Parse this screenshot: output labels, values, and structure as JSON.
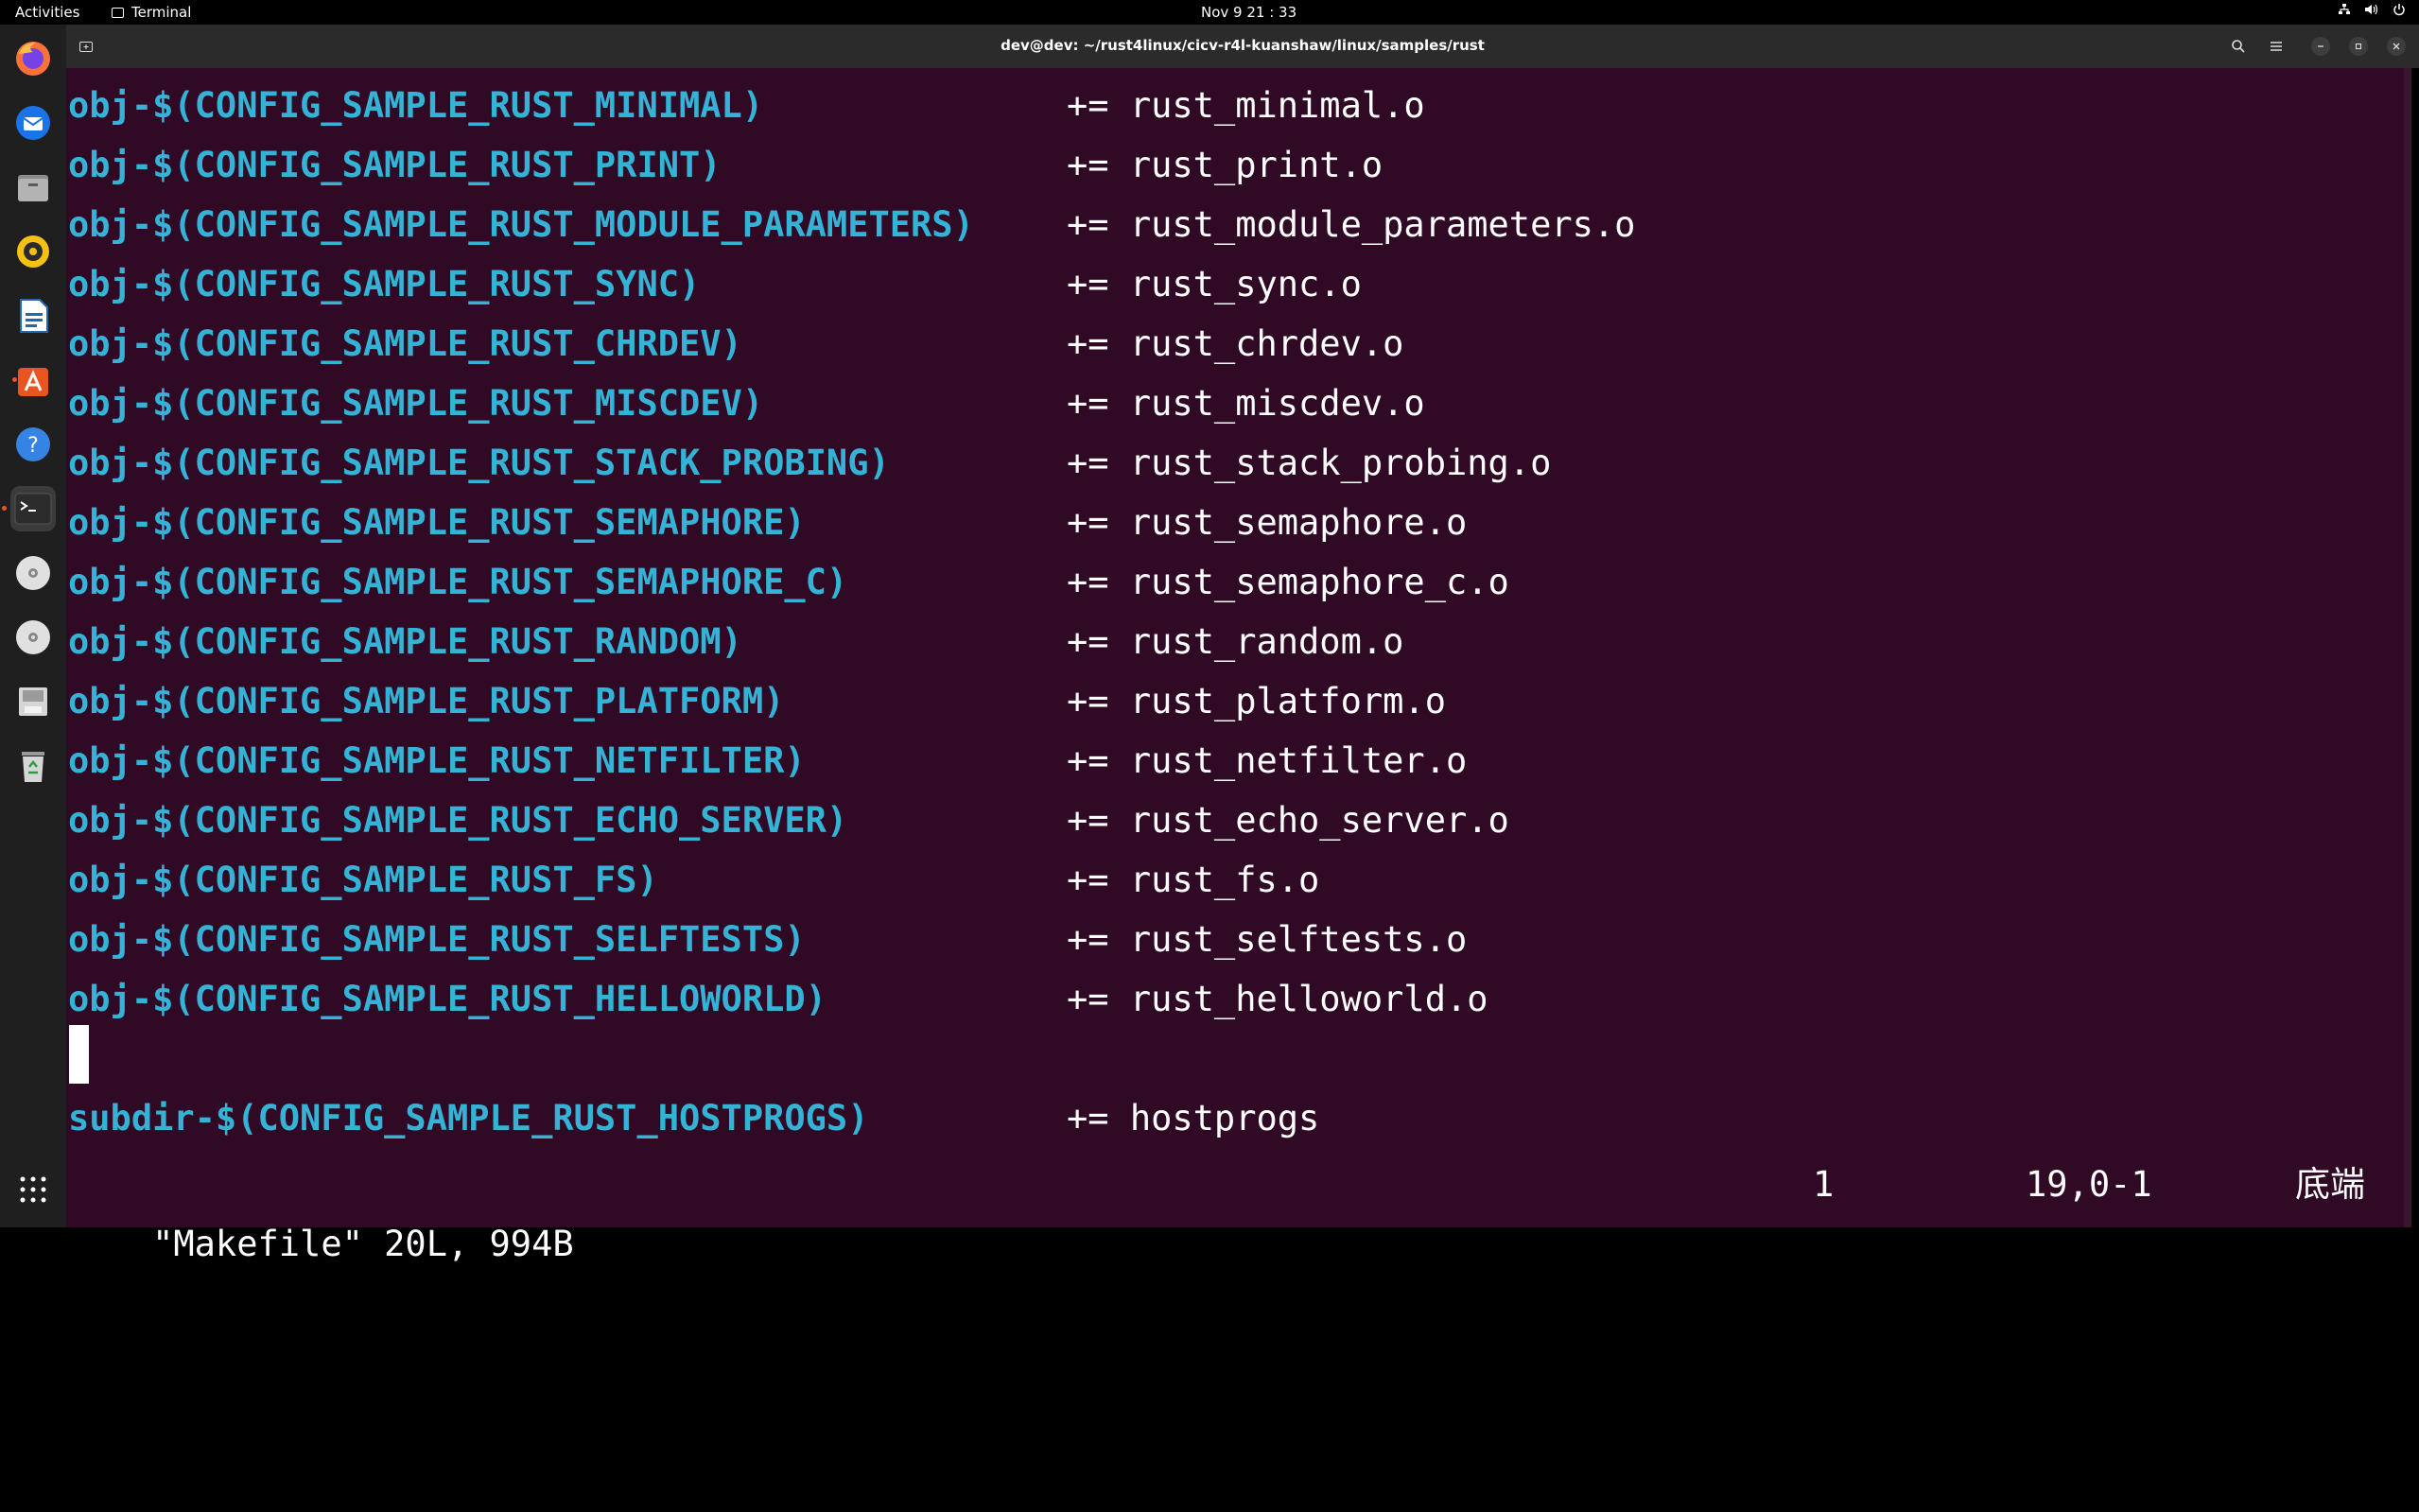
{
  "topbar": {
    "activities": "Activities",
    "app_name": "Terminal",
    "clock": "Nov 9  21 : 33",
    "sys_icons": [
      "network-icon",
      "volume-icon",
      "power-icon"
    ]
  },
  "dock": {
    "items": [
      {
        "name": "firefox-icon"
      },
      {
        "name": "thunderbird-icon"
      },
      {
        "name": "files-icon"
      },
      {
        "name": "rhythmbox-icon"
      },
      {
        "name": "libreoffice-writer-icon"
      },
      {
        "name": "app-center-icon"
      },
      {
        "name": "help-icon"
      },
      {
        "name": "terminal-icon"
      },
      {
        "name": "disc-drive-icon"
      },
      {
        "name": "disc-drive-icon"
      },
      {
        "name": "save-drive-icon"
      },
      {
        "name": "trash-icon"
      }
    ],
    "apps_grid_icon": "show-apps-icon"
  },
  "window": {
    "title": "dev@dev: ~/rust4linux/cicv-r4l-kuanshaw/linux/samples/rust",
    "new_tab_icon": "new-tab-icon",
    "search_icon": "search-icon",
    "menu_icon": "hamburger-menu-icon"
  },
  "terminal": {
    "lines": [
      {
        "var": "obj-$(CONFIG_SAMPLE_RUST_MINIMAL)",
        "op": "+= rust_minimal.o"
      },
      {
        "var": "obj-$(CONFIG_SAMPLE_RUST_PRINT)",
        "op": "+= rust_print.o"
      },
      {
        "var": "obj-$(CONFIG_SAMPLE_RUST_MODULE_PARAMETERS)",
        "op": "+= rust_module_parameters.o"
      },
      {
        "var": "obj-$(CONFIG_SAMPLE_RUST_SYNC)",
        "op": "+= rust_sync.o"
      },
      {
        "var": "obj-$(CONFIG_SAMPLE_RUST_CHRDEV)",
        "op": "+= rust_chrdev.o"
      },
      {
        "var": "obj-$(CONFIG_SAMPLE_RUST_MISCDEV)",
        "op": "+= rust_miscdev.o"
      },
      {
        "var": "obj-$(CONFIG_SAMPLE_RUST_STACK_PROBING)",
        "op": "+= rust_stack_probing.o"
      },
      {
        "var": "obj-$(CONFIG_SAMPLE_RUST_SEMAPHORE)",
        "op": "+= rust_semaphore.o"
      },
      {
        "var": "obj-$(CONFIG_SAMPLE_RUST_SEMAPHORE_C)",
        "op": "+= rust_semaphore_c.o"
      },
      {
        "var": "obj-$(CONFIG_SAMPLE_RUST_RANDOM)",
        "op": "+= rust_random.o"
      },
      {
        "var": "obj-$(CONFIG_SAMPLE_RUST_PLATFORM)",
        "op": "+= rust_platform.o"
      },
      {
        "var": "obj-$(CONFIG_SAMPLE_RUST_NETFILTER)",
        "op": "+= rust_netfilter.o"
      },
      {
        "var": "obj-$(CONFIG_SAMPLE_RUST_ECHO_SERVER)",
        "op": "+= rust_echo_server.o"
      },
      {
        "var": "obj-$(CONFIG_SAMPLE_RUST_FS)",
        "op": "+= rust_fs.o"
      },
      {
        "var": "obj-$(CONFIG_SAMPLE_RUST_SELFTESTS)",
        "op": "+= rust_selftests.o"
      },
      {
        "var": "obj-$(CONFIG_SAMPLE_RUST_HELLOWORLD)",
        "op": "+= rust_helloworld.o"
      },
      {
        "var": "",
        "op": ""
      },
      {
        "var": "subdir-$(CONFIG_SAMPLE_RUST_HOSTPROGS)",
        "op": "+= hostprogs"
      }
    ],
    "status": {
      "file_info": "\"Makefile\" 20L, 994B",
      "showcmd": "1",
      "position": "19,0-1",
      "percentage": "底端"
    }
  },
  "colors": {
    "terminal_bg": "#300a24",
    "variable_fg": "#34b3d6",
    "text_fg": "#ffffff",
    "accent": "#e95420"
  }
}
